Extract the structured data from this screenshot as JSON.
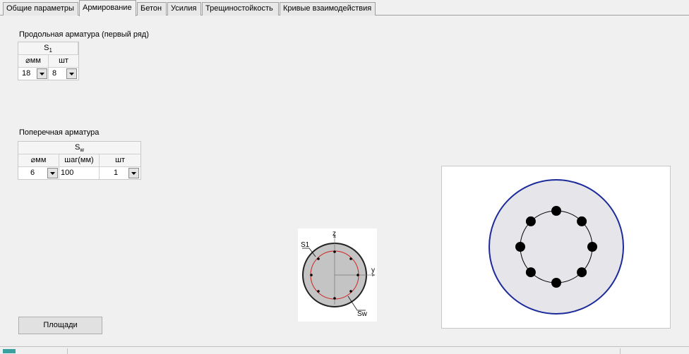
{
  "tabs": [
    {
      "label": "Общие параметры",
      "active": false
    },
    {
      "label": "Армирование",
      "active": true
    },
    {
      "label": "Бетон",
      "active": false
    },
    {
      "label": "Усилия",
      "active": false
    },
    {
      "label": "Трещиностойкость",
      "active": false
    },
    {
      "label": "Кривые взаимодействия",
      "active": false
    }
  ],
  "longitudinal": {
    "title": "Продольная арматура (первый ряд)",
    "group_label": "S",
    "group_sub": "1",
    "col_diameter": "мм",
    "col_count": "шт",
    "diameter": "18",
    "count": "8"
  },
  "transverse": {
    "title": "Поперечная арматура",
    "group_label": "S",
    "group_sub": "w",
    "col_diameter": "мм",
    "col_step": "шаг(мм)",
    "col_count": "шт",
    "diameter": "6",
    "step": "100",
    "count": "1"
  },
  "areas_button": "Площади",
  "scheme": {
    "axis_z": "z",
    "axis_y": "y",
    "label_s1": "S1",
    "label_sw": "Sw"
  },
  "preview": {
    "bar_count": 8,
    "outer_color": "#1c2a9a",
    "fill_color": "#e6e6ea"
  },
  "colors": {
    "window_bg": "#f0f0f0",
    "stirrup_red": "#cc2222"
  }
}
